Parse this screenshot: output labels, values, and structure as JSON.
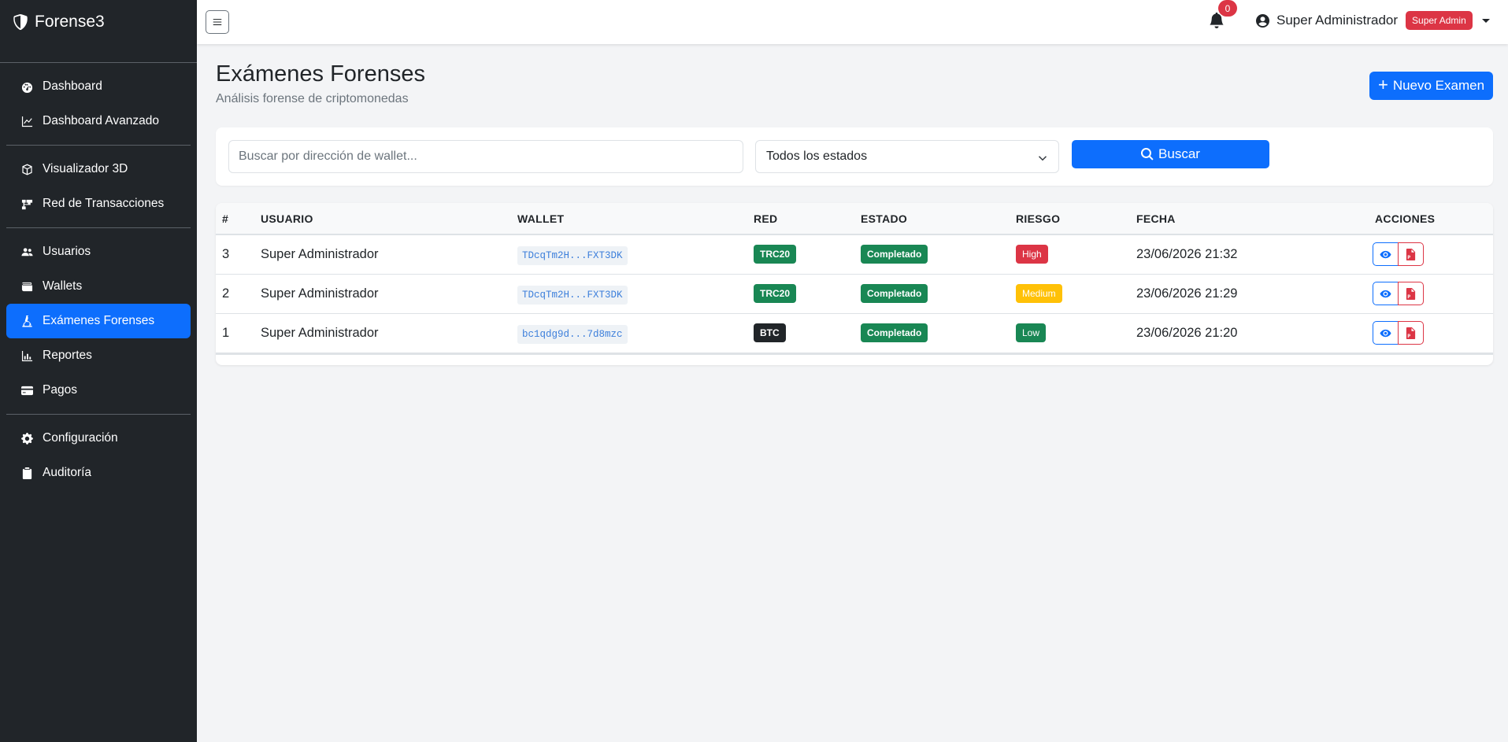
{
  "brand": {
    "name": "Forense3",
    "icon": "shield-icon"
  },
  "sidebar": {
    "groups": [
      [
        {
          "label": "Dashboard",
          "icon": "speedometer-icon",
          "active": false
        },
        {
          "label": "Dashboard Avanzado",
          "icon": "line-chart-icon",
          "active": false
        }
      ],
      [
        {
          "label": "Visualizador 3D",
          "icon": "cube-icon",
          "active": false
        },
        {
          "label": "Red de Transacciones",
          "icon": "network-icon",
          "active": false
        }
      ],
      [
        {
          "label": "Usuarios",
          "icon": "users-icon",
          "active": false
        },
        {
          "label": "Wallets",
          "icon": "wallet-icon",
          "active": false
        },
        {
          "label": "Exámenes Forenses",
          "icon": "microscope-icon",
          "active": true
        },
        {
          "label": "Reportes",
          "icon": "bar-chart-icon",
          "active": false
        },
        {
          "label": "Pagos",
          "icon": "credit-card-icon",
          "active": false
        }
      ],
      [
        {
          "label": "Configuración",
          "icon": "gear-icon",
          "active": false
        },
        {
          "label": "Auditoría",
          "icon": "clipboard-icon",
          "active": false
        }
      ]
    ]
  },
  "topbar": {
    "notifications_count": "0",
    "user_name": "Super Administrador",
    "role_badge": "Super Admin"
  },
  "header": {
    "title": "Exámenes Forenses",
    "subtitle": "Análisis forense de criptomonedas",
    "new_button": "Nuevo Examen"
  },
  "filters": {
    "search_placeholder": "Buscar por dirección de wallet...",
    "search_value": "",
    "state_selected": "Todos los estados",
    "search_button": "Buscar"
  },
  "table": {
    "columns": [
      "#",
      "USUARIO",
      "WALLET",
      "RED",
      "ESTADO",
      "RIESGO",
      "FECHA",
      "ACCIONES"
    ],
    "rows": [
      {
        "id": "3",
        "user": "Super Administrador",
        "wallet": "TDcqTm2H...FXT3DK",
        "network": "TRC20",
        "network_color": "#198754",
        "status": "Completado",
        "risk": "High",
        "risk_color": "#dc3545",
        "date": "23/06/2026 21:32"
      },
      {
        "id": "2",
        "user": "Super Administrador",
        "wallet": "TDcqTm2H...FXT3DK",
        "network": "TRC20",
        "network_color": "#198754",
        "status": "Completado",
        "risk": "Medium",
        "risk_color": "#ffc107",
        "date": "23/06/2026 21:29"
      },
      {
        "id": "1",
        "user": "Super Administrador",
        "wallet": "bc1qdg9d...7d8mzc",
        "network": "BTC",
        "network_color": "#212529",
        "status": "Completado",
        "risk": "Low",
        "risk_color": "#198754",
        "date": "23/06/2026 21:20"
      }
    ]
  },
  "colors": {
    "sidebar_bg": "#212529",
    "primary": "#0d6efd",
    "danger": "#dc3545",
    "success": "#198754",
    "warning": "#ffc107"
  }
}
